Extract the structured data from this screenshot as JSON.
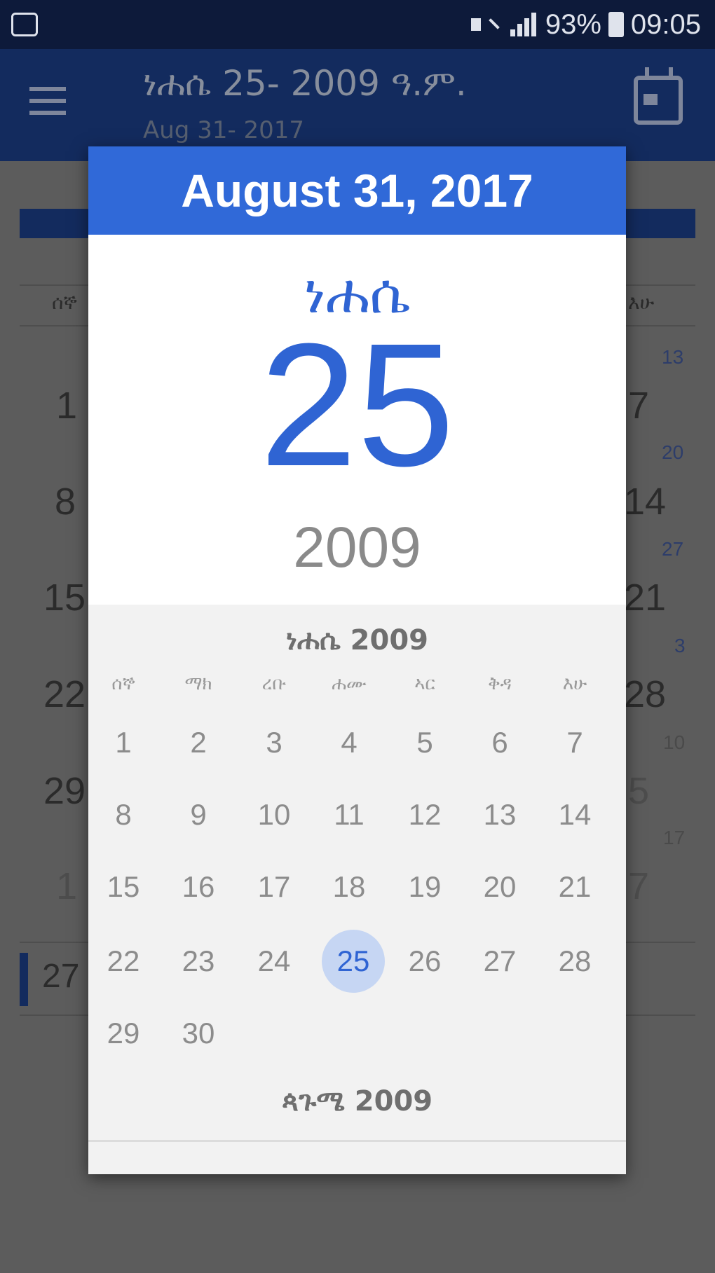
{
  "status_bar": {
    "battery": "93%",
    "time": "09:05"
  },
  "app_bar": {
    "title": "ነሐሴ 25- 2009 ዓ.ም.",
    "subtitle": "Aug 31- 2017"
  },
  "background": {
    "left_dates": [
      "1",
      "8",
      "15",
      "22",
      "29",
      "1"
    ],
    "right_dates": [
      "7",
      "14",
      "21",
      "28",
      "5",
      "7"
    ],
    "right_small": [
      "13",
      "20",
      "27",
      "3",
      "10",
      "17"
    ],
    "bottom_row": "27",
    "left_weekday": "ሰኞ",
    "right_weekday": "እሁ"
  },
  "dialog": {
    "header": "August 31, 2017",
    "ethiopian_month": "ነሐሴ",
    "day": "25",
    "year": "2009",
    "month_label": "ነሐሴ 2009",
    "weekdays": [
      "ሰኞ",
      "ማክ",
      "ረቡ",
      "ሐሙ",
      "ኣር",
      "ቅዳ",
      "እሁ"
    ],
    "weeks": [
      [
        "1",
        "2",
        "3",
        "4",
        "5",
        "6",
        "7"
      ],
      [
        "8",
        "9",
        "10",
        "11",
        "12",
        "13",
        "14"
      ],
      [
        "15",
        "16",
        "17",
        "18",
        "19",
        "20",
        "21"
      ],
      [
        "22",
        "23",
        "24",
        "25",
        "26",
        "27",
        "28"
      ],
      [
        "29",
        "30",
        "",
        "",
        "",
        "",
        ""
      ]
    ],
    "selected_day": "25",
    "next_month_label": "ጳጉሜ 2009"
  },
  "colors": {
    "status_bar": "#0d1a3a",
    "app_bar": "#132b5e",
    "dialog_header": "#3069d8",
    "accent": "#2f64d3",
    "selected_circle": "#c6d6f3"
  }
}
